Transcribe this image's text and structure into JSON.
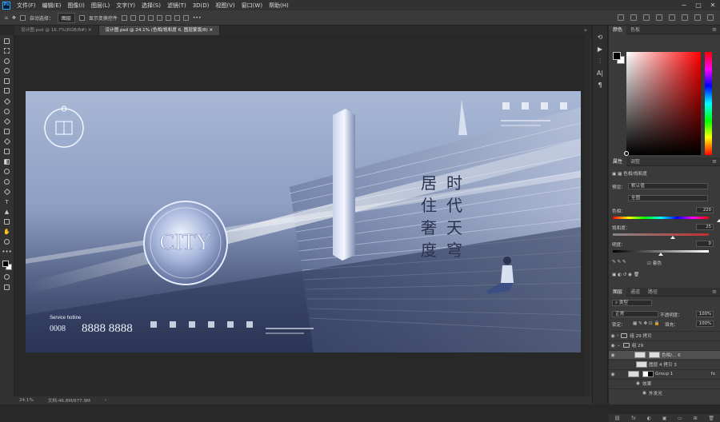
{
  "app": {
    "logo_text": "Ps"
  },
  "menu": [
    "文件(F)",
    "编辑(E)",
    "图像(I)",
    "图层(L)",
    "文字(Y)",
    "选择(S)",
    "滤镜(T)",
    "3D(D)",
    "视图(V)",
    "窗口(W)",
    "帮助(H)"
  ],
  "window_controls": [
    "−",
    "▢",
    "✕"
  ],
  "options": {
    "auto_select_label": "自动选择：",
    "layer_select_value": "图层",
    "transform_label": "显示变换控件"
  },
  "tabs": [
    {
      "label": "设计图.psd @ 16.7%(RGB/8#)",
      "close": "✕"
    },
    {
      "label": "设计图.psd @ 24.1% (色相/饱和度 6, 图层蒙版/8)",
      "close": "✕"
    }
  ],
  "tabs_arrow": "»",
  "artwork": {
    "title_col1": "时代天穹",
    "title_col2": "居住奢度",
    "ring_text": "CITY",
    "hotline_label": "Service hotline",
    "hotline_prefix": "0008",
    "hotline_number": "8888 8888"
  },
  "status": {
    "zoom": "24.1%",
    "doc": "文档:46.8M/877.9M",
    "arrow": "›"
  },
  "iconcol": [
    "▶",
    "⫶",
    "A|",
    "¶"
  ],
  "color_panel": {
    "tabs": [
      "颜色",
      "色板"
    ]
  },
  "properties": {
    "tabs": [
      "属性",
      "调整"
    ],
    "adj_name": "色相/饱和度",
    "preset_label": "预设：",
    "preset_value": "默认值",
    "channel_value": "全图",
    "hue_label": "色相：",
    "hue_value": "220",
    "sat_label": "饱和度：",
    "sat_value": "25",
    "light_label": "明度：",
    "light_value": "0",
    "colorize_label": "着色"
  },
  "layers_panel": {
    "tabs": [
      "图层",
      "通道",
      "路径"
    ],
    "filter_value": "类型",
    "blend_value": "正常",
    "opacity_label": "不透明度：",
    "opacity_value": "100%",
    "lock_label": "锁定：",
    "fill_label": "填充：",
    "fill_value": "100%",
    "rows": [
      {
        "name": "组 29 拷贝",
        "kind": "folder"
      },
      {
        "name": "组 29",
        "kind": "folder"
      },
      {
        "name": "色相/... 6",
        "kind": "adj"
      },
      {
        "name": "图层 4 拷贝 3",
        "kind": "pixel"
      },
      {
        "name": "Group 1",
        "kind": "group"
      },
      {
        "name": "效果",
        "kind": "fx"
      },
      {
        "name": "外发光",
        "kind": "fx"
      }
    ],
    "footer_icons": [
      "⛓",
      "fx",
      "◐",
      "▣",
      "▭",
      "⊞",
      "🗑"
    ]
  }
}
